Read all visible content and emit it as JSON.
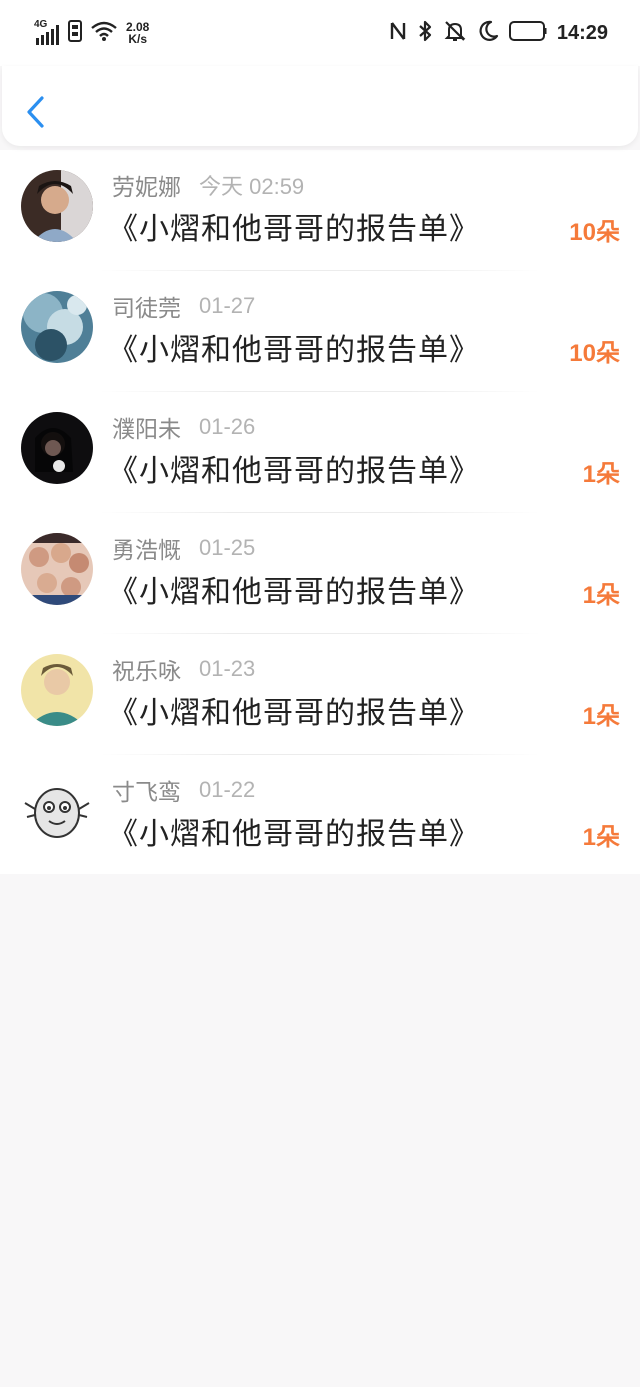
{
  "status_bar": {
    "network": "4G",
    "speed_value": "2.08",
    "speed_unit": "K/s",
    "time": "14:29",
    "icons": [
      "signal-icon",
      "sim-icon",
      "wifi-icon",
      "nfc-icon",
      "bluetooth-icon",
      "mute-icon",
      "moon-icon",
      "battery-icon"
    ]
  },
  "header": {
    "back_icon": "chevron-left-icon",
    "accent_color": "#2b8ff0"
  },
  "colors": {
    "count": "#f57a3a",
    "name": "#8a8a8a",
    "date": "#b3b3b3"
  },
  "gifts": [
    {
      "name": "劳妮娜",
      "date": "今天 02:59",
      "title": "《小熠和他哥哥的报告单》",
      "count": "10朵"
    },
    {
      "name": "司徒莞",
      "date": "01-27",
      "title": "《小熠和他哥哥的报告单》",
      "count": "10朵"
    },
    {
      "name": "濮阳未",
      "date": "01-26",
      "title": "《小熠和他哥哥的报告单》",
      "count": "1朵"
    },
    {
      "name": "勇浩慨",
      "date": "01-25",
      "title": "《小熠和他哥哥的报告单》",
      "count": "1朵"
    },
    {
      "name": "祝乐咏",
      "date": "01-23",
      "title": "《小熠和他哥哥的报告单》",
      "count": "1朵"
    },
    {
      "name": "寸飞鸾",
      "date": "01-22",
      "title": "《小熠和他哥哥的报告单》",
      "count": "1朵"
    }
  ]
}
